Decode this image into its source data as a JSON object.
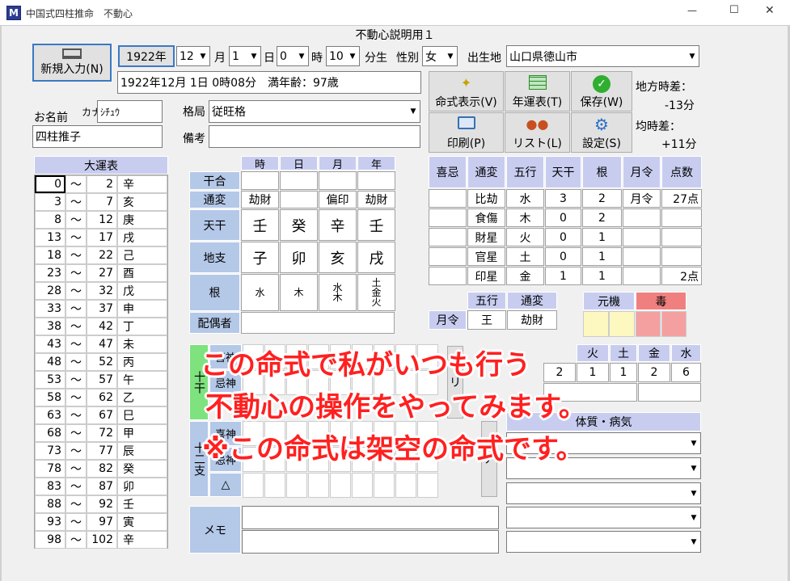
{
  "window": {
    "title": "中国式四柱推命　不動心",
    "controls": [
      "—",
      "☐",
      "✕"
    ]
  },
  "doc_title": "不動心説明用１",
  "new_input_label": "新規入力(N)",
  "birth": {
    "year": "1922年",
    "month": "12",
    "day": "1",
    "hour": "0",
    "minute": "10",
    "minute_unit": "分生",
    "gender_label": "性別",
    "gender": "女",
    "place_label": "出生地",
    "place": "山口県徳山市",
    "month_unit": "月",
    "day_unit": "日",
    "hour_unit": "時"
  },
  "birth_summary": "1922年12月 1日 0時08分　満年齢：97歳",
  "name": {
    "label": "お名前",
    "kana_label": "カナ",
    "kana": "ｼﾁｭｳ",
    "value": "四柱推子"
  },
  "kakkyoku": {
    "label": "格局",
    "value": "従旺格"
  },
  "biko": {
    "label": "備考",
    "value": ""
  },
  "tools": [
    "命式表示(V)",
    "年運表(T)",
    "保存(W)",
    "印刷(P)",
    "リスト(L)",
    "設定(S)"
  ],
  "time_diff": {
    "local_label": "地方時差：",
    "local": "-13分",
    "avg_label": "均時差：",
    "avg": "+11分"
  },
  "daiun": {
    "title": "大運表",
    "tilde": "～",
    "rows": [
      [
        "0",
        "2",
        "辛"
      ],
      [
        "3",
        "7",
        "亥"
      ],
      [
        "8",
        "12",
        "庚"
      ],
      [
        "13",
        "17",
        "戌"
      ],
      [
        "18",
        "22",
        "己"
      ],
      [
        "23",
        "27",
        "酉"
      ],
      [
        "28",
        "32",
        "戊"
      ],
      [
        "33",
        "37",
        "申"
      ],
      [
        "38",
        "42",
        "丁"
      ],
      [
        "43",
        "47",
        "未"
      ],
      [
        "48",
        "52",
        "丙"
      ],
      [
        "53",
        "57",
        "午"
      ],
      [
        "58",
        "62",
        "乙"
      ],
      [
        "63",
        "67",
        "巳"
      ],
      [
        "68",
        "72",
        "甲"
      ],
      [
        "73",
        "77",
        "辰"
      ],
      [
        "78",
        "82",
        "癸"
      ],
      [
        "83",
        "87",
        "卯"
      ],
      [
        "88",
        "92",
        "壬"
      ],
      [
        "93",
        "97",
        "寅"
      ],
      [
        "98",
        "102",
        "辛"
      ]
    ]
  },
  "pillars": {
    "cols": [
      "時",
      "日",
      "月",
      "年"
    ],
    "kango_label": "干合",
    "tsuhen_label": "通変",
    "tenkan_label": "天干",
    "chishi_label": "地支",
    "ne_label": "根",
    "haigusha_label": "配偶者",
    "tsuhen": [
      "劫財",
      "",
      "偏印",
      "劫財"
    ],
    "tenkan": [
      "壬",
      "癸",
      "辛",
      "壬"
    ],
    "chishi": [
      "子",
      "卯",
      "亥",
      "戌"
    ],
    "ne": [
      "水",
      "木",
      "水\n木",
      "土\n金\n火"
    ]
  },
  "gogyo": {
    "headers": [
      "喜忌",
      "通変",
      "五行",
      "天干",
      "根",
      "月令",
      "点数"
    ],
    "rows": [
      [
        "",
        "比劫",
        "水",
        "3",
        "2",
        "月令",
        "27点"
      ],
      [
        "",
        "食傷",
        "木",
        "0",
        "2",
        "",
        ""
      ],
      [
        "",
        "財星",
        "火",
        "0",
        "1",
        "",
        ""
      ],
      [
        "",
        "官星",
        "土",
        "0",
        "1",
        "",
        ""
      ],
      [
        "",
        "印星",
        "金",
        "1",
        "1",
        "",
        "2点"
      ]
    ]
  },
  "getsurei": {
    "label": "月令",
    "h_gogyo": "五行",
    "h_tsuhen": "通変",
    "gogyo": "王",
    "tsuhen": "劫財"
  },
  "genki": {
    "label": "元機",
    "doku_label": "毒"
  },
  "bottom": {
    "jikkan_label": "十干",
    "junishi_label": "十二支",
    "kishin_label": "喜神",
    "kijin_label": "忌神",
    "koushin_label": "忌神",
    "triangle": "△",
    "ri": "リ",
    "a": "ア",
    "right_headers": [
      "火",
      "土",
      "金",
      "水"
    ],
    "right_values": [
      "1",
      "1",
      "2",
      "6"
    ],
    "left_val": "2",
    "taishitsu_label": "体質・病気",
    "memo_label": "メモ"
  },
  "overlay": [
    "この命式で私がいつも行う",
    "不動心の操作をやってみます。",
    "※この命式は架空の命式です。"
  ]
}
